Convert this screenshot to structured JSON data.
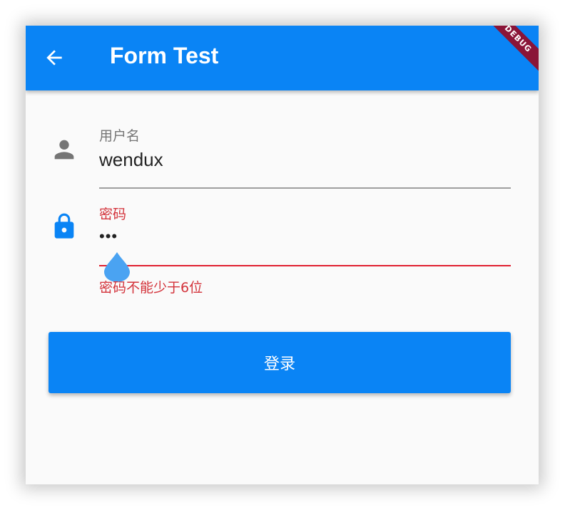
{
  "appbar": {
    "title": "Form Test",
    "back_icon": "arrow-back-icon",
    "color": "#0a84f5",
    "debug_banner": "DEBUG"
  },
  "form": {
    "username": {
      "icon": "person-icon",
      "label": "用户名",
      "value": "wendux"
    },
    "password": {
      "icon": "lock-icon",
      "label": "密码",
      "value": "•••",
      "error": "密码不能少于6位",
      "error_color": "#d3323a"
    }
  },
  "login_button": {
    "label": "登录"
  }
}
